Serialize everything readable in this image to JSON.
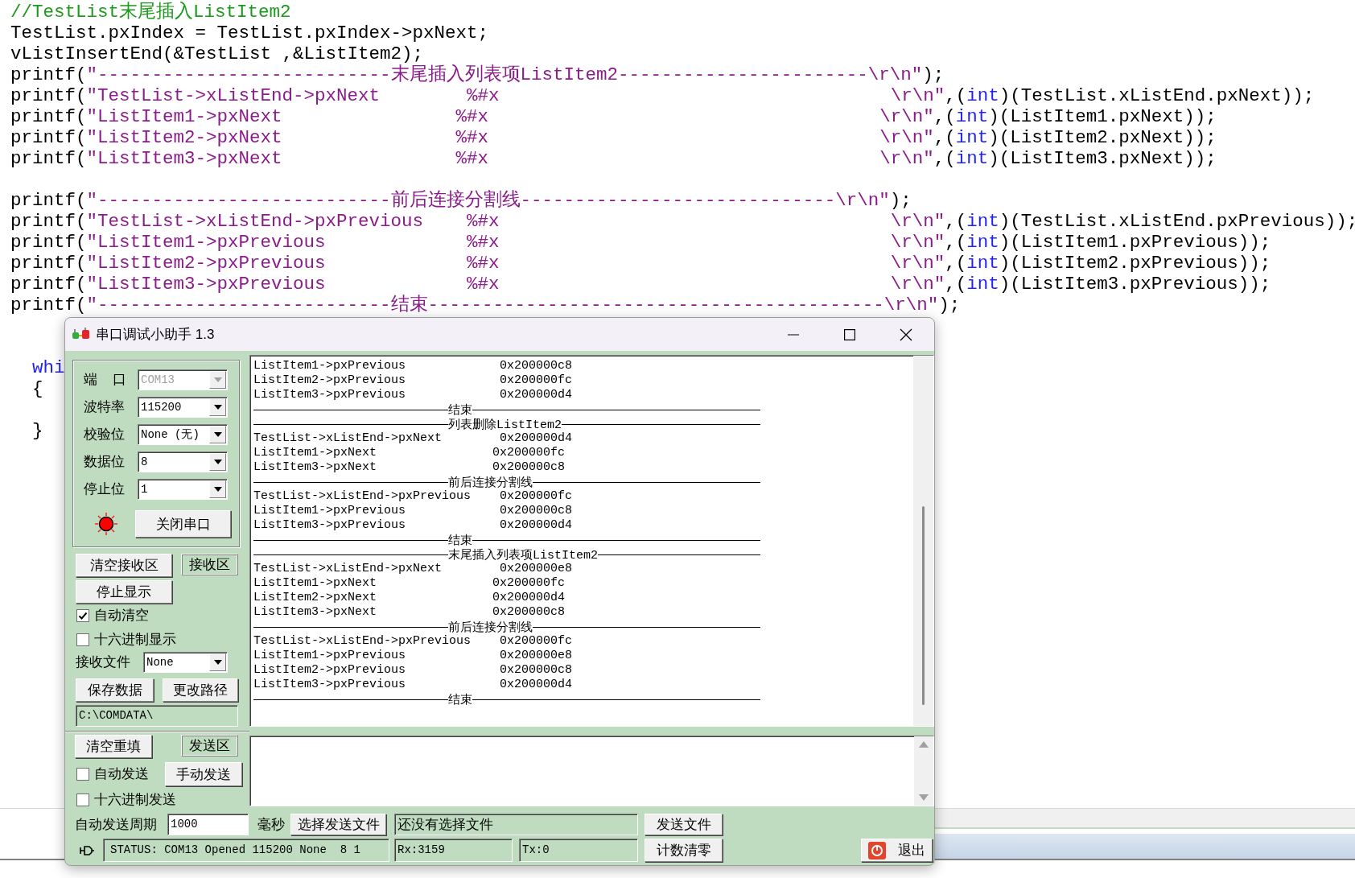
{
  "editor": {
    "lines": [
      {
        "kind": "code",
        "tokens": [
          {
            "kind": "comment",
            "text": "//TestList末尾插入ListItem2"
          }
        ]
      },
      {
        "kind": "code",
        "tokens": [
          {
            "kind": "plain",
            "text": "TestList.pxIndex = TestList.pxIndex->pxNext;"
          }
        ]
      },
      {
        "kind": "code",
        "tokens": [
          {
            "kind": "plain",
            "text": "vListInsertEnd(&TestList ,&ListItem2);"
          }
        ]
      },
      {
        "kind": "code",
        "tokens": [
          {
            "kind": "plain",
            "text": "printf("
          },
          {
            "kind": "string",
            "text": "\"---------------------------末尾插入列表项ListItem2-----------------------\\r\\n\""
          },
          {
            "kind": "plain",
            "text": ");"
          }
        ]
      },
      {
        "kind": "code",
        "tokens": [
          {
            "kind": "plain",
            "text": "printf("
          },
          {
            "kind": "string",
            "text": "\"TestList->xListEnd->pxNext        %#x                                    \\r\\n\""
          },
          {
            "kind": "plain",
            "text": ",("
          },
          {
            "kind": "keyword",
            "text": "int"
          },
          {
            "kind": "plain",
            "text": ")(TestList.xListEnd.pxNext));"
          }
        ]
      },
      {
        "kind": "code",
        "tokens": [
          {
            "kind": "plain",
            "text": "printf("
          },
          {
            "kind": "string",
            "text": "\"ListItem1->pxNext                %#x                                    \\r\\n\""
          },
          {
            "kind": "plain",
            "text": ",("
          },
          {
            "kind": "keyword",
            "text": "int"
          },
          {
            "kind": "plain",
            "text": ")(ListItem1.pxNext));"
          }
        ]
      },
      {
        "kind": "code",
        "tokens": [
          {
            "kind": "plain",
            "text": "printf("
          },
          {
            "kind": "string",
            "text": "\"ListItem2->pxNext                %#x                                    \\r\\n\""
          },
          {
            "kind": "plain",
            "text": ",("
          },
          {
            "kind": "keyword",
            "text": "int"
          },
          {
            "kind": "plain",
            "text": ")(ListItem2.pxNext));"
          }
        ]
      },
      {
        "kind": "code",
        "tokens": [
          {
            "kind": "plain",
            "text": "printf("
          },
          {
            "kind": "string",
            "text": "\"ListItem3->pxNext                %#x                                    \\r\\n\""
          },
          {
            "kind": "plain",
            "text": ",("
          },
          {
            "kind": "keyword",
            "text": "int"
          },
          {
            "kind": "plain",
            "text": ")(ListItem3.pxNext));"
          }
        ]
      },
      {
        "kind": "blank"
      },
      {
        "kind": "code",
        "tokens": [
          {
            "kind": "plain",
            "text": "printf("
          },
          {
            "kind": "string",
            "text": "\"---------------------------前后连接分割线-----------------------------\\r\\n\""
          },
          {
            "kind": "plain",
            "text": ");"
          }
        ]
      },
      {
        "kind": "code",
        "tokens": [
          {
            "kind": "plain",
            "text": "printf("
          },
          {
            "kind": "string",
            "text": "\"TestList->xListEnd->pxPrevious    %#x                                    \\r\\n\""
          },
          {
            "kind": "plain",
            "text": ",("
          },
          {
            "kind": "keyword",
            "text": "int"
          },
          {
            "kind": "plain",
            "text": ")(TestList.xListEnd.pxPrevious));"
          }
        ]
      },
      {
        "kind": "code",
        "tokens": [
          {
            "kind": "plain",
            "text": "printf("
          },
          {
            "kind": "string",
            "text": "\"ListItem1->pxPrevious             %#x                                    \\r\\n\""
          },
          {
            "kind": "plain",
            "text": ",("
          },
          {
            "kind": "keyword",
            "text": "int"
          },
          {
            "kind": "plain",
            "text": ")(ListItem1.pxPrevious));"
          }
        ]
      },
      {
        "kind": "code",
        "tokens": [
          {
            "kind": "plain",
            "text": "printf("
          },
          {
            "kind": "string",
            "text": "\"ListItem2->pxPrevious             %#x                                    \\r\\n\""
          },
          {
            "kind": "plain",
            "text": ",("
          },
          {
            "kind": "keyword",
            "text": "int"
          },
          {
            "kind": "plain",
            "text": ")(ListItem2.pxPrevious));"
          }
        ]
      },
      {
        "kind": "code",
        "tokens": [
          {
            "kind": "plain",
            "text": "printf("
          },
          {
            "kind": "string",
            "text": "\"ListItem3->pxPrevious             %#x                                    \\r\\n\""
          },
          {
            "kind": "plain",
            "text": ",("
          },
          {
            "kind": "keyword",
            "text": "int"
          },
          {
            "kind": "plain",
            "text": ")(ListItem3.pxPrevious));"
          }
        ]
      },
      {
        "kind": "code",
        "tokens": [
          {
            "kind": "plain",
            "text": "printf("
          },
          {
            "kind": "string",
            "text": "\"---------------------------结束------------------------------------------\\r\\n\""
          },
          {
            "kind": "plain",
            "text": ");"
          }
        ]
      },
      {
        "kind": "blank"
      },
      {
        "kind": "blank"
      },
      {
        "kind": "code",
        "tokens": [
          {
            "kind": "keyword",
            "text": "  whi"
          }
        ]
      },
      {
        "kind": "code",
        "tokens": [
          {
            "kind": "plain",
            "text": "  {"
          }
        ]
      },
      {
        "kind": "blank"
      },
      {
        "kind": "code",
        "tokens": [
          {
            "kind": "plain",
            "text": "  }"
          }
        ]
      }
    ]
  },
  "serial_window": {
    "title": "串口调试小助手 1.3",
    "settings": [
      {
        "label": "端 口",
        "value": "COM13",
        "disabled": true
      },
      {
        "label": "波特率",
        "value": "115200",
        "disabled": false
      },
      {
        "label": "校验位",
        "value": "None (无)",
        "disabled": false
      },
      {
        "label": "数据位",
        "value": "8",
        "disabled": false
      },
      {
        "label": "停止位",
        "value": "1",
        "disabled": false
      }
    ],
    "led": {
      "on": true
    },
    "port_button": "关闭串口",
    "receive_controls": {
      "clear_button": "清空接收区",
      "area_label": "接收区",
      "stop_button": "停止显示",
      "checkboxes": [
        {
          "label": "自动清空",
          "checked": true
        },
        {
          "label": "十六进制显示",
          "checked": false
        }
      ],
      "file_label": "接收文件",
      "file_value": "None",
      "save_button": "保存数据",
      "path_button": "更改路径",
      "path": "C:\\COMDATA\\"
    },
    "receive_lines": [
      {
        "kind": "value",
        "text": "ListItem1->pxPrevious             0x200000c8"
      },
      {
        "kind": "value",
        "text": "ListItem2->pxPrevious             0x200000fc"
      },
      {
        "kind": "value",
        "text": "ListItem3->pxPrevious             0x200000d4"
      },
      {
        "kind": "separator",
        "text": "结束"
      },
      {
        "kind": "separator",
        "text": "列表删除ListItem2"
      },
      {
        "kind": "value",
        "text": "TestList->xListEnd->pxNext        0x200000d4"
      },
      {
        "kind": "value",
        "text": "ListItem1->pxNext                0x200000fc"
      },
      {
        "kind": "value",
        "text": "ListItem3->pxNext                0x200000c8"
      },
      {
        "kind": "separator",
        "text": "前后连接分割线"
      },
      {
        "kind": "value",
        "text": "TestList->xListEnd->pxPrevious    0x200000fc"
      },
      {
        "kind": "value",
        "text": "ListItem1->pxPrevious             0x200000c8"
      },
      {
        "kind": "value",
        "text": "ListItem3->pxPrevious             0x200000d4"
      },
      {
        "kind": "separator",
        "text": "结束"
      },
      {
        "kind": "separator",
        "text": "末尾插入列表项ListItem2"
      },
      {
        "kind": "value",
        "text": "TestList->xListEnd->pxNext        0x200000e8"
      },
      {
        "kind": "value",
        "text": "ListItem1->pxNext                0x200000fc"
      },
      {
        "kind": "value",
        "text": "ListItem2->pxNext                0x200000d4"
      },
      {
        "kind": "value",
        "text": "ListItem3->pxNext                0x200000c8"
      },
      {
        "kind": "separator",
        "text": "前后连接分割线"
      },
      {
        "kind": "value",
        "text": "TestList->xListEnd->pxPrevious    0x200000fc"
      },
      {
        "kind": "value",
        "text": "ListItem1->pxPrevious             0x200000e8"
      },
      {
        "kind": "value",
        "text": "ListItem2->pxPrevious             0x200000c8"
      },
      {
        "kind": "value",
        "text": "ListItem3->pxPrevious             0x200000d4"
      },
      {
        "kind": "separator",
        "text": "结束"
      }
    ],
    "send_controls": {
      "clear_button": "清空重填",
      "area_label": "发送区",
      "auto_send": {
        "label": "自动发送",
        "checked": false
      },
      "manual_button": "手动发送",
      "hex_send": {
        "label": "十六进制发送",
        "checked": false
      },
      "period_label": "自动发送周期",
      "period_value": "1000",
      "period_unit": "毫秒",
      "choose_file_button": "选择发送文件",
      "file_status": "还没有选择文件",
      "send_file_button": "发送文件"
    },
    "status_bar": {
      "status": "STATUS: COM13 Opened 115200 None  8 1",
      "rx": "Rx:3159",
      "tx": "Tx:0",
      "reset_button": "计数清零",
      "exit_button": "退出"
    }
  }
}
